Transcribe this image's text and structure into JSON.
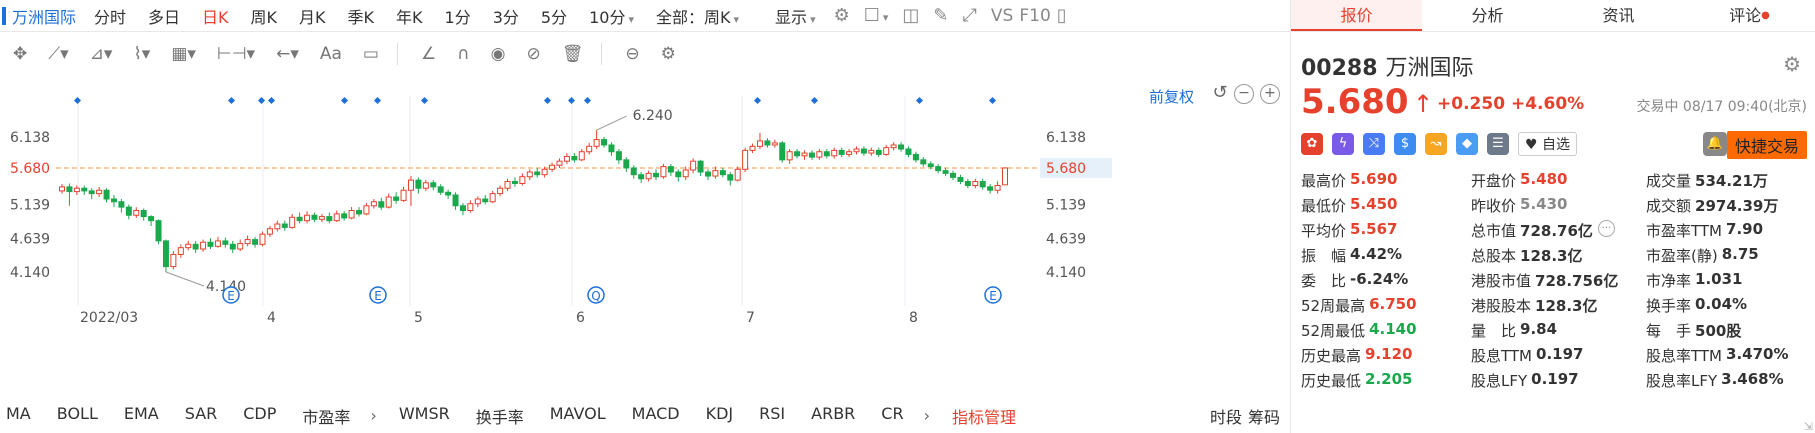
{
  "topbar": {
    "stock_name": "万洲国际",
    "periods": [
      "分时",
      "多日",
      "日K",
      "周K",
      "月K",
      "季K",
      "年K",
      "1分",
      "3分",
      "5分",
      "10分"
    ],
    "active_period": "日K",
    "range_select": "全部：周K",
    "display": "显示",
    "vs": "VS",
    "f10": "F10"
  },
  "drawbar": {
    "icons": [
      "crosshair-icon",
      "line-icon",
      "polyline-icon",
      "wave-icon",
      "fib-icon",
      "range-icon",
      "arrow-icon",
      "text-icon",
      "comment-icon",
      "pencil-icon",
      "magnet-icon",
      "eye-icon",
      "hide-icon",
      "trash-icon",
      "link-icon",
      "settings-icon"
    ],
    "text_tool": "Aa"
  },
  "chart_data": {
    "type": "candlestick",
    "price_axis_ticks": [
      "6.138",
      "5.680",
      "5.139",
      "4.639",
      "4.140"
    ],
    "tick_values": [
      6.138,
      5.68,
      5.139,
      4.639,
      4.14
    ],
    "current_price": 5.68,
    "high_label": "6.240",
    "low_label": "4.140",
    "x_labels": [
      "2022/03",
      "4",
      "5",
      "6",
      "7",
      "8"
    ],
    "adjust_label": "前复权",
    "event_markers": [
      "E",
      "E",
      "Q",
      "E"
    ],
    "candles": [
      [
        5.34,
        5.4,
        5.44,
        5.3
      ],
      [
        5.4,
        5.33,
        5.45,
        5.12
      ],
      [
        5.33,
        5.38,
        5.42,
        5.28
      ],
      [
        5.38,
        5.34,
        5.42,
        5.28
      ],
      [
        5.34,
        5.3,
        5.38,
        5.22
      ],
      [
        5.3,
        5.35,
        5.4,
        5.25
      ],
      [
        5.35,
        5.22,
        5.38,
        5.17
      ],
      [
        5.22,
        5.18,
        5.28,
        5.1
      ],
      [
        5.18,
        5.1,
        5.22,
        5.02
      ],
      [
        5.1,
        4.98,
        5.14,
        4.92
      ],
      [
        4.98,
        5.05,
        5.1,
        4.94
      ],
      [
        5.05,
        4.96,
        5.08,
        4.9
      ],
      [
        4.96,
        4.9,
        4.98,
        4.82
      ],
      [
        4.9,
        4.6,
        4.92,
        4.55
      ],
      [
        4.6,
        4.22,
        4.62,
        4.14
      ],
      [
        4.22,
        4.4,
        4.45,
        4.18
      ],
      [
        4.4,
        4.5,
        4.55,
        4.35
      ],
      [
        4.5,
        4.55,
        4.6,
        4.46
      ],
      [
        4.55,
        4.48,
        4.6,
        4.42
      ],
      [
        4.48,
        4.58,
        4.62,
        4.44
      ],
      [
        4.58,
        4.52,
        4.64,
        4.48
      ],
      [
        4.52,
        4.6,
        4.66,
        4.5
      ],
      [
        4.6,
        4.55,
        4.65,
        4.5
      ],
      [
        4.55,
        4.48,
        4.6,
        4.42
      ],
      [
        4.48,
        4.56,
        4.62,
        4.45
      ],
      [
        4.56,
        4.62,
        4.68,
        4.52
      ],
      [
        4.62,
        4.55,
        4.66,
        4.5
      ],
      [
        4.55,
        4.7,
        4.74,
        4.52
      ],
      [
        4.7,
        4.78,
        4.82,
        4.66
      ],
      [
        4.78,
        4.85,
        4.9,
        4.74
      ],
      [
        4.85,
        4.8,
        4.9,
        4.75
      ],
      [
        4.8,
        4.95,
        5.0,
        4.78
      ],
      [
        4.95,
        4.9,
        5.02,
        4.86
      ],
      [
        4.9,
        4.98,
        5.04,
        4.86
      ],
      [
        4.98,
        4.92,
        5.02,
        4.88
      ],
      [
        4.92,
        4.96,
        5.0,
        4.88
      ],
      [
        4.96,
        4.9,
        5.02,
        4.86
      ],
      [
        4.9,
        5.0,
        5.05,
        4.88
      ],
      [
        5.0,
        4.94,
        5.04,
        4.9
      ],
      [
        4.94,
        5.05,
        5.1,
        4.92
      ],
      [
        5.05,
        5.0,
        5.1,
        4.96
      ],
      [
        5.0,
        5.12,
        5.16,
        4.98
      ],
      [
        5.12,
        5.18,
        5.22,
        5.08
      ],
      [
        5.18,
        5.1,
        5.24,
        5.06
      ],
      [
        5.1,
        5.25,
        5.3,
        5.08
      ],
      [
        5.25,
        5.2,
        5.32,
        5.15
      ],
      [
        5.2,
        5.35,
        5.4,
        5.18
      ],
      [
        5.35,
        5.5,
        5.56,
        5.12
      ],
      [
        5.5,
        5.38,
        5.54,
        5.3
      ],
      [
        5.38,
        5.46,
        5.5,
        5.34
      ],
      [
        5.46,
        5.4,
        5.5,
        5.35
      ],
      [
        5.4,
        5.32,
        5.44,
        5.28
      ],
      [
        5.32,
        5.28,
        5.36,
        5.22
      ],
      [
        5.28,
        5.12,
        5.32,
        5.06
      ],
      [
        5.12,
        5.05,
        5.16,
        4.98
      ],
      [
        5.05,
        5.15,
        5.2,
        5.02
      ],
      [
        5.15,
        5.22,
        5.26,
        5.1
      ],
      [
        5.22,
        5.18,
        5.28,
        5.14
      ],
      [
        5.18,
        5.3,
        5.34,
        5.16
      ],
      [
        5.3,
        5.38,
        5.42,
        5.26
      ],
      [
        5.38,
        5.48,
        5.52,
        5.34
      ],
      [
        5.48,
        5.45,
        5.54,
        5.4
      ],
      [
        5.45,
        5.55,
        5.6,
        5.42
      ],
      [
        5.55,
        5.62,
        5.66,
        5.5
      ],
      [
        5.62,
        5.58,
        5.68,
        5.54
      ],
      [
        5.58,
        5.66,
        5.7,
        5.54
      ],
      [
        5.66,
        5.72,
        5.76,
        5.62
      ],
      [
        5.72,
        5.78,
        5.82,
        5.68
      ],
      [
        5.78,
        5.85,
        5.9,
        5.74
      ],
      [
        5.85,
        5.8,
        5.9,
        5.76
      ],
      [
        5.8,
        5.92,
        5.96,
        5.78
      ],
      [
        5.92,
        6.0,
        6.05,
        5.88
      ],
      [
        6.0,
        6.1,
        6.24,
        5.96
      ],
      [
        6.1,
        6.02,
        6.14,
        5.98
      ],
      [
        6.02,
        5.92,
        6.06,
        5.86
      ],
      [
        5.92,
        5.8,
        5.96,
        5.74
      ],
      [
        5.8,
        5.68,
        5.84,
        5.62
      ],
      [
        5.68,
        5.58,
        5.72,
        5.52
      ],
      [
        5.58,
        5.52,
        5.62,
        5.46
      ],
      [
        5.52,
        5.6,
        5.64,
        5.48
      ],
      [
        5.6,
        5.55,
        5.66,
        5.5
      ],
      [
        5.55,
        5.7,
        5.74,
        5.52
      ],
      [
        5.7,
        5.62,
        5.74,
        5.56
      ],
      [
        5.62,
        5.55,
        5.66,
        5.48
      ],
      [
        5.55,
        5.65,
        5.7,
        5.5
      ],
      [
        5.65,
        5.78,
        5.82,
        5.6
      ],
      [
        5.78,
        5.62,
        5.8,
        5.56
      ],
      [
        5.62,
        5.56,
        5.66,
        5.5
      ],
      [
        5.56,
        5.64,
        5.7,
        5.52
      ],
      [
        5.64,
        5.58,
        5.68,
        5.54
      ],
      [
        5.58,
        5.5,
        5.62,
        5.42
      ],
      [
        5.5,
        5.66,
        5.7,
        5.48
      ],
      [
        5.66,
        5.94,
        5.98,
        5.62
      ],
      [
        5.94,
        6.0,
        6.04,
        5.9
      ],
      [
        6.0,
        6.08,
        6.2,
        5.96
      ],
      [
        6.08,
        6.02,
        6.12,
        5.98
      ],
      [
        6.02,
        6.05,
        6.1,
        5.98
      ],
      [
        6.05,
        5.8,
        6.08,
        5.76
      ],
      [
        5.8,
        5.92,
        5.96,
        5.74
      ],
      [
        5.92,
        5.86,
        5.96,
        5.82
      ],
      [
        5.86,
        5.9,
        5.94,
        5.8
      ],
      [
        5.9,
        5.84,
        5.94,
        5.8
      ],
      [
        5.84,
        5.92,
        5.96,
        5.8
      ],
      [
        5.92,
        5.86,
        5.96,
        5.82
      ],
      [
        5.86,
        5.94,
        5.98,
        5.82
      ],
      [
        5.94,
        5.88,
        5.98,
        5.84
      ],
      [
        5.88,
        5.92,
        5.96,
        5.84
      ],
      [
        5.92,
        5.96,
        6.0,
        5.88
      ],
      [
        5.96,
        5.9,
        6.0,
        5.86
      ],
      [
        5.9,
        5.94,
        5.98,
        5.86
      ],
      [
        5.94,
        5.88,
        5.98,
        5.84
      ],
      [
        5.88,
        5.98,
        6.02,
        5.86
      ],
      [
        5.98,
        6.02,
        6.06,
        5.94
      ],
      [
        6.02,
        5.96,
        6.06,
        5.92
      ],
      [
        5.96,
        5.88,
        6.0,
        5.84
      ],
      [
        5.88,
        5.8,
        5.92,
        5.76
      ],
      [
        5.8,
        5.74,
        5.84,
        5.7
      ],
      [
        5.74,
        5.7,
        5.78,
        5.66
      ],
      [
        5.7,
        5.64,
        5.74,
        5.6
      ],
      [
        5.64,
        5.6,
        5.68,
        5.56
      ],
      [
        5.6,
        5.54,
        5.64,
        5.5
      ],
      [
        5.54,
        5.48,
        5.58,
        5.44
      ],
      [
        5.48,
        5.42,
        5.52,
        5.38
      ],
      [
        5.42,
        5.48,
        5.52,
        5.38
      ],
      [
        5.48,
        5.4,
        5.52,
        5.36
      ],
      [
        5.4,
        5.35,
        5.44,
        5.3
      ],
      [
        5.35,
        5.42,
        5.48,
        5.3
      ],
      [
        5.43,
        5.68,
        5.69,
        5.45
      ]
    ],
    "colors": {
      "up": "#e5412d",
      "down": "#1aa84d",
      "price_line": "#f39a4b",
      "marker": "#1e6fd9"
    }
  },
  "panel": {
    "tabs": [
      "报价",
      "分析",
      "资讯",
      "评论"
    ],
    "code": "00288",
    "name": "万洲国际",
    "price": "5.680",
    "change": "+0.250",
    "change_pct": "+4.60%",
    "status": "交易中 08/17 09:40(北京)",
    "badges": [
      {
        "icon": "hk-flag-icon",
        "glyph": "✿",
        "color": "#e5412d"
      },
      {
        "icon": "connect-icon",
        "glyph": "ϟ",
        "color": "#7a5be8"
      },
      {
        "icon": "shuffle-icon",
        "glyph": "⤨",
        "color": "#4a7bf5"
      },
      {
        "icon": "dollar-icon",
        "glyph": "$",
        "color": "#3d8cf0"
      },
      {
        "icon": "trend-icon",
        "glyph": "↝",
        "color": "#f5a623"
      },
      {
        "icon": "tag-icon",
        "glyph": "◆",
        "color": "#4a9cf5"
      },
      {
        "icon": "doc-icon",
        "glyph": "☰",
        "color": "#6e7a8a"
      }
    ],
    "watch_label": "自选",
    "trade_label": "快捷交易",
    "stats": [
      [
        [
          "最高价",
          "5.690",
          "up"
        ],
        [
          "开盘价",
          "5.480",
          "up"
        ],
        [
          "成交量",
          "534.21万",
          ""
        ]
      ],
      [
        [
          "最低价",
          "5.450",
          "up"
        ],
        [
          "昨收价",
          "5.430",
          "gray"
        ],
        [
          "成交额",
          "2974.39万",
          ""
        ]
      ],
      [
        [
          "平均价",
          "5.567",
          "up"
        ],
        [
          "总市值",
          "728.76亿",
          ""
        ],
        [
          "市盈率TTM",
          "7.90",
          ""
        ]
      ],
      [
        [
          "振　幅",
          "4.42%",
          ""
        ],
        [
          "总股本",
          "128.3亿",
          ""
        ],
        [
          "市盈率(静)",
          "8.75",
          ""
        ]
      ],
      [
        [
          "委　比",
          "-6.24%",
          ""
        ],
        [
          "港股市值",
          "728.756亿",
          ""
        ],
        [
          "市净率",
          "1.031",
          ""
        ]
      ],
      [
        [
          "52周最高",
          "6.750",
          "up"
        ],
        [
          "港股股本",
          "128.3亿",
          ""
        ],
        [
          "换手率",
          "0.04%",
          ""
        ]
      ],
      [
        [
          "52周最低",
          "4.140",
          "down"
        ],
        [
          "量　比",
          "9.84",
          ""
        ],
        [
          "每　手",
          "500股",
          ""
        ]
      ],
      [
        [
          "历史最高",
          "9.120",
          "up"
        ],
        [
          "股息TTM",
          "0.197",
          ""
        ],
        [
          "股息率TTM",
          "3.470%",
          ""
        ]
      ],
      [
        [
          "历史最低",
          "2.205",
          "down"
        ],
        [
          "股息LFY",
          "0.197",
          ""
        ],
        [
          "股息率LFY",
          "3.468%",
          ""
        ]
      ]
    ]
  },
  "indicators": {
    "items": [
      "MA",
      "BOLL",
      "EMA",
      "SAR",
      "CDP",
      "市盈率"
    ],
    "items2": [
      "WMSR",
      "换手率",
      "MAVOL",
      "MACD",
      "KDJ",
      "RSI",
      "ARBR",
      "CR"
    ],
    "manage": "指标管理",
    "right": [
      "时段",
      "筹码"
    ]
  }
}
